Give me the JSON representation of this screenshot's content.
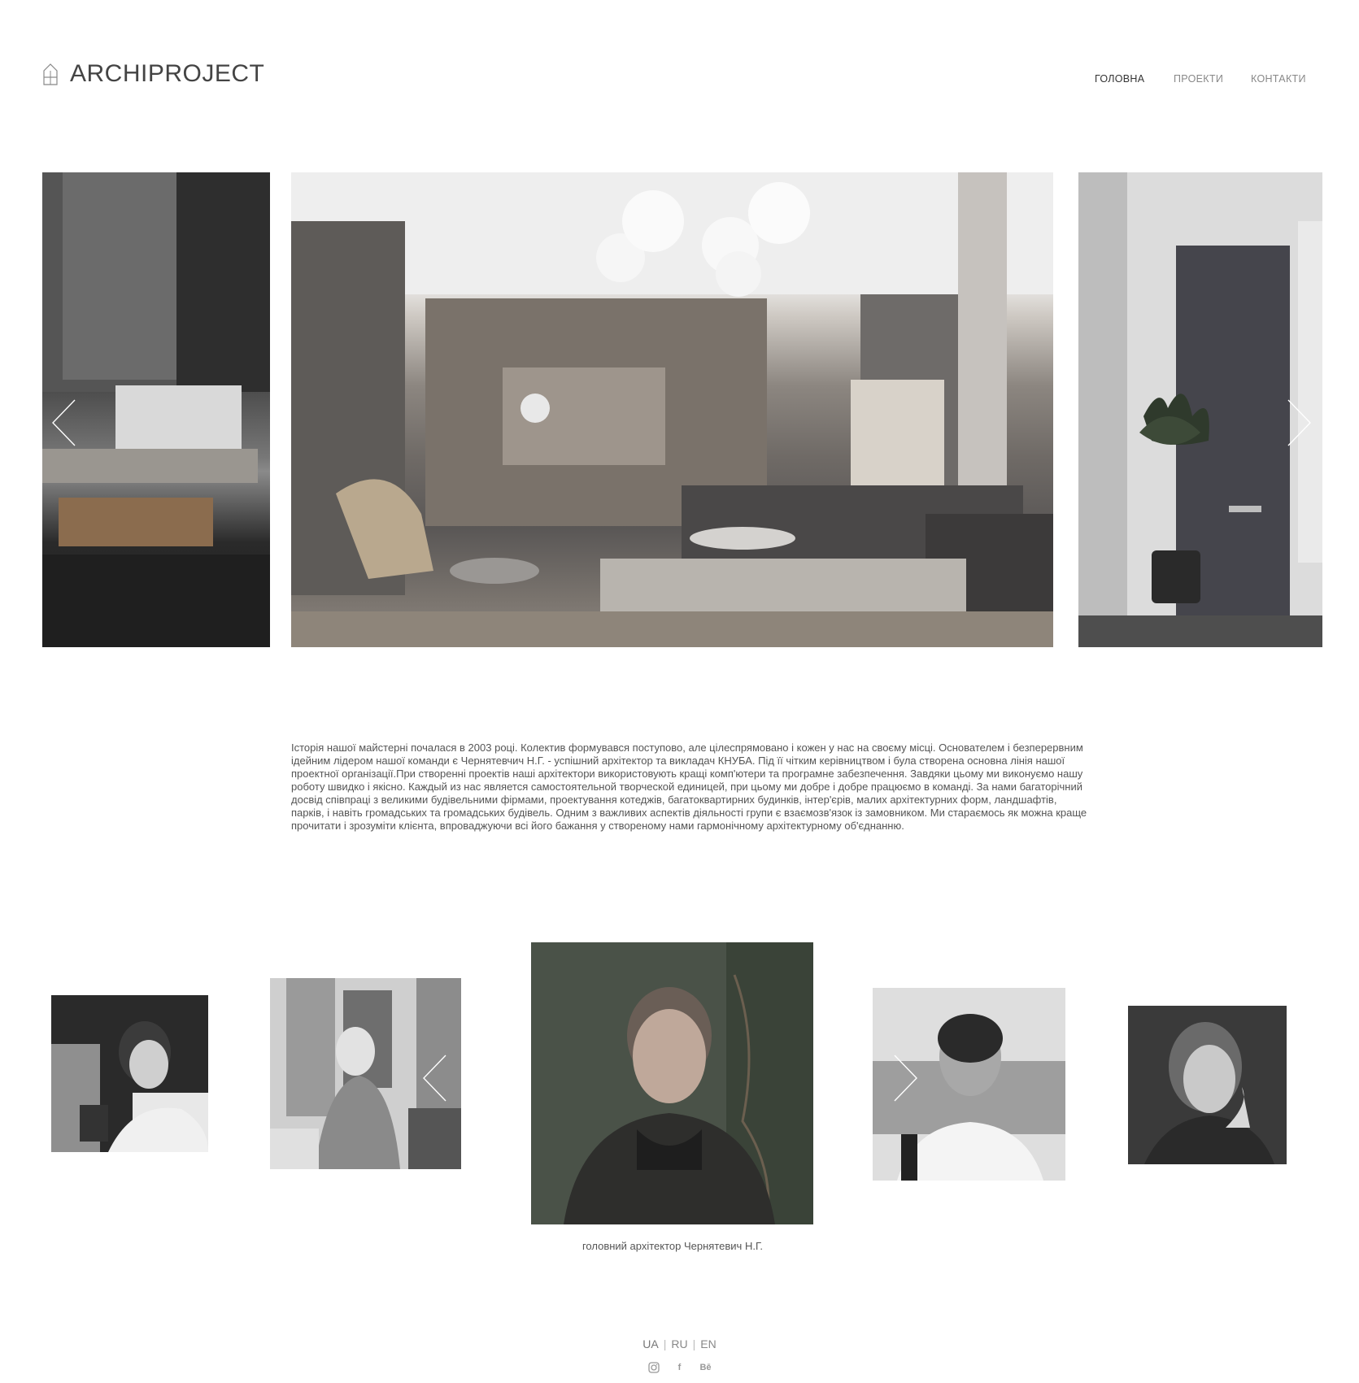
{
  "header": {
    "logo_text": "ARCHIPROJECT",
    "nav": [
      {
        "label": "ГОЛОВНА",
        "active": true
      },
      {
        "label": "ПРОЕКТИ",
        "active": false
      },
      {
        "label": "КОНТАКТИ",
        "active": false
      }
    ]
  },
  "slider": {
    "slides": [
      "interior-fireplace",
      "interior-living-room",
      "interior-plant-window"
    ]
  },
  "about": {
    "text": "Історія нашої майстерні почалася в 2003 році. Колектив формувався поступово, але цілеспрямовано і кожен у нас на своєму місці. Основателем і безперервним ідейним лідером нашої команди є Чернятевчич Н.Г. - успішний архітектор та викладач КНУБА. Під її чітким керівництвом і була створена основна лінія нашої проектної організації.При створенні проектів наші архітектори використовують кращі комп'ютери та програмне забезпечення. Завдяки цьому ми виконуємо нашу роботу швидко і якісно. Каждый из нас является самостоятельной творческой единицей, при цьому ми добре і добре працюємо в команді. За нами багаторічний досвід співпраці з великими будівельними фірмами, проектування котеджів, багатоквартирних будинків, інтер'єрів, малих архітектурних форм, ландшафтів, парків, і навіть громадських та громадських будівель. Одним з важливих аспектів діяльності групи є взаємозв'язок із замовником. Ми стараємось як можна краще прочитати і зрозуміти клієнта, впроваджуючи всі його бажання у створеному нами гармонічному архітектурному об'єднанню."
  },
  "team": {
    "caption": "головний архітектор Чернятевич Н.Г."
  },
  "footer": {
    "languages": [
      "UA",
      "RU",
      "EN"
    ],
    "separator": "|",
    "socials": [
      {
        "icon": "instagram-icon"
      },
      {
        "icon": "facebook-icon",
        "glyph": "f"
      },
      {
        "icon": "behance-icon",
        "glyph": "Bē"
      }
    ]
  }
}
